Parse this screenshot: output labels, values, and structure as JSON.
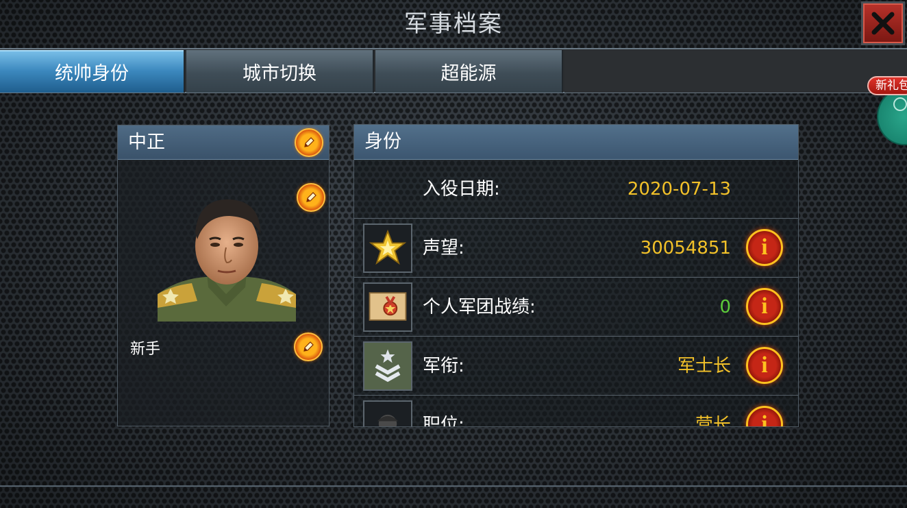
{
  "header": {
    "title": "军事档案",
    "close_icon": "close-x-icon"
  },
  "tabs": [
    {
      "label": "统帅身份",
      "active": true
    },
    {
      "label": "城市切换",
      "active": false
    },
    {
      "label": "超能源",
      "active": false
    }
  ],
  "gift_badge": {
    "label": "新礼包"
  },
  "profile": {
    "name": "中正",
    "rank_title": "新手",
    "edit_icon": "pencil-icon"
  },
  "identity": {
    "heading": "身份",
    "rows": [
      {
        "label": "入役日期:",
        "value": "2020-07-13",
        "icon": null,
        "has_info": false
      },
      {
        "label": "声望:",
        "value": "30054851",
        "icon": "gold-star-icon",
        "has_info": true
      },
      {
        "label": "个人军团战绩:",
        "value": "0",
        "icon": "medal-certificate-icon",
        "has_info": true,
        "value_color": "#5ccb3a"
      },
      {
        "label": "军衔:",
        "value": "军士长",
        "icon": "sergeant-chevron-icon",
        "has_info": true
      },
      {
        "label": "职位:",
        "value": "营长",
        "icon": "soldier-salute-icon",
        "has_info": true
      }
    ]
  },
  "colors": {
    "accent_gold": "#f2c129",
    "accent_green": "#5ccb3a",
    "tab_active": "#3b87bd",
    "close_red": "#b8322a"
  }
}
